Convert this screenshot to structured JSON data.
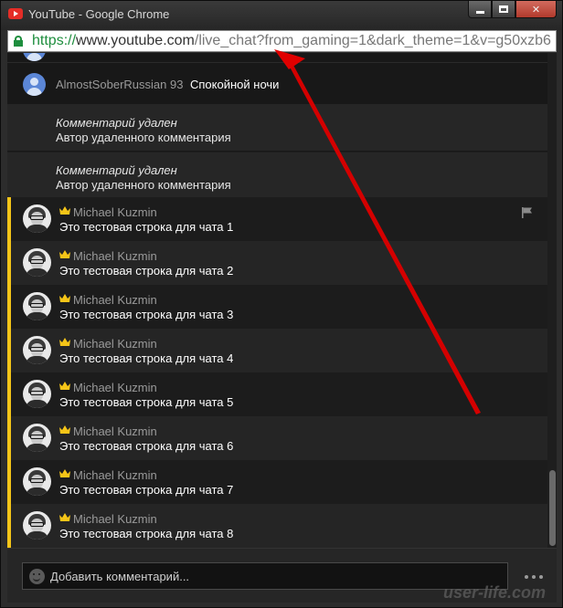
{
  "window": {
    "title": "YouTube - Google Chrome",
    "controls": {
      "minimize": "—",
      "maximize": "☐",
      "close": "✕"
    }
  },
  "address_bar": {
    "scheme": "https://",
    "host": "www.youtube.com",
    "path": "/live_chat?from_gaming=1&dark_theme=1&v=g50xzb6",
    "lock_color": "#1e8e3e"
  },
  "chat": {
    "top_message": {
      "author": "AlmostSoberRussian 93",
      "text": "Спокойной ночи"
    },
    "deleted": [
      {
        "title": "Комментарий удален",
        "subtitle": "Автор удаленного комментария"
      },
      {
        "title": "Комментарий удален",
        "subtitle": "Автор удаленного комментария"
      }
    ],
    "owner_messages": [
      {
        "author": "Michael Kuzmin",
        "text": "Это тестовая строка для чата 1"
      },
      {
        "author": "Michael Kuzmin",
        "text": "Это тестовая строка для чата 2"
      },
      {
        "author": "Michael Kuzmin",
        "text": "Это тестовая строка для чата 3"
      },
      {
        "author": "Michael Kuzmin",
        "text": "Это тестовая строка для чата 4"
      },
      {
        "author": "Michael Kuzmin",
        "text": "Это тестовая строка для чата 5"
      },
      {
        "author": "Michael Kuzmin",
        "text": "Это тестовая строка для чата 6"
      },
      {
        "author": "Michael Kuzmin",
        "text": "Это тестовая строка для чата 7"
      },
      {
        "author": "Michael Kuzmin",
        "text": "Это тестовая строка для чата 8"
      }
    ],
    "owner_accent": "#f5c518"
  },
  "input": {
    "placeholder": "Добавить комментарий..."
  },
  "watermark": "user-life.com",
  "annotation_color": "#e00000"
}
